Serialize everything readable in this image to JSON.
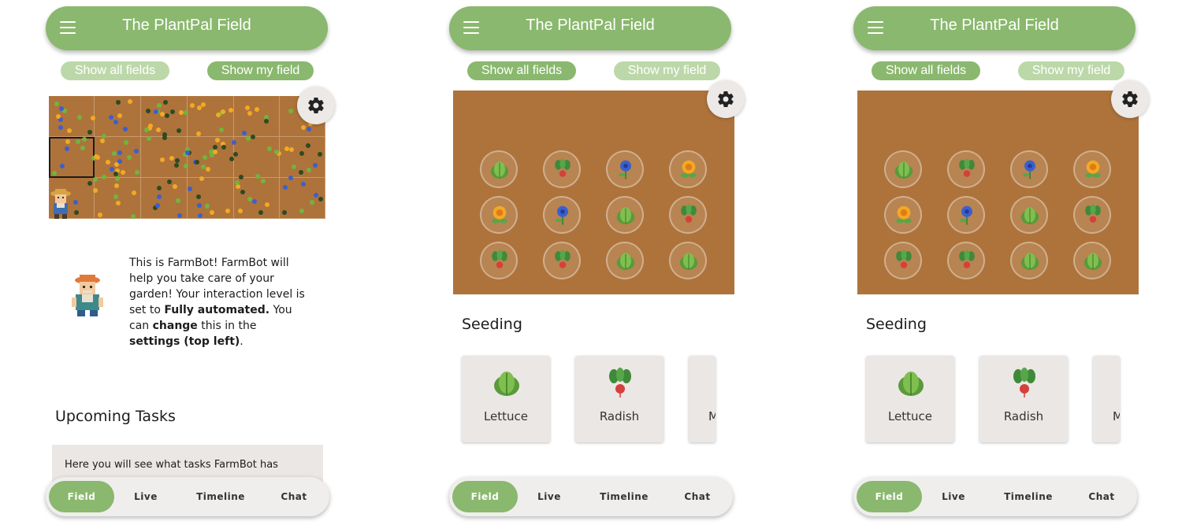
{
  "app": {
    "title": "The PlantPal Field"
  },
  "toggles": {
    "all": "Show all fields",
    "mine": "Show my field"
  },
  "farmbot": {
    "part1": "This is FarmBot! FarmBot will help you take care of your garden! Your interaction level is set to ",
    "bold1": "Fully automated.",
    "part2": " You can ",
    "bold2": "change",
    "part3": " this in the ",
    "bold3": "settings (top left)",
    "part4": "."
  },
  "tasks": {
    "title": "Upcoming Tasks",
    "text": "Here you will see what tasks FarmBot has"
  },
  "seeding": {
    "title": "Seeding",
    "items": [
      "Lettuce",
      "Radish",
      "M"
    ]
  },
  "field_grid": [
    [
      "lettuce",
      "radish",
      "cornflower",
      "marigold"
    ],
    [
      "marigold",
      "cornflower",
      "lettuce",
      "radish"
    ],
    [
      "radish",
      "radish",
      "lettuce",
      "lettuce"
    ]
  ],
  "nav": {
    "field": "Field",
    "live": "Live",
    "timeline": "Timeline",
    "chat": "Chat"
  },
  "icons": {
    "menu": "menu-icon",
    "settings": "gear-icon",
    "farmbot": "farmer-icon"
  },
  "colors": {
    "accent": "#8ab86e",
    "accent_light": "#bcd8a9",
    "soil": "#ae733b",
    "card": "#ebe7e4"
  }
}
